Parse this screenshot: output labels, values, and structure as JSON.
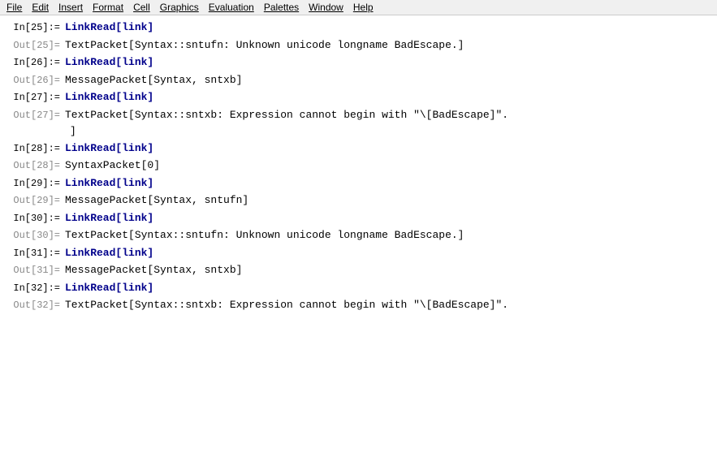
{
  "menu": {
    "items": [
      "File",
      "Edit",
      "Insert",
      "Format",
      "Cell",
      "Graphics",
      "Evaluation",
      "Palettes",
      "Window",
      "Help"
    ]
  },
  "cells": [
    {
      "id": 1,
      "in_label": "In[25]:=",
      "out_label": null,
      "type": "input",
      "content": "LinkRead[link]"
    },
    {
      "id": 2,
      "in_label": null,
      "out_label": "Out[25]=",
      "type": "output",
      "content": "TextPacket[Syntax::sntufn: Unknown unicode longname BadEscape.]"
    },
    {
      "id": 3,
      "in_label": "In[26]:=",
      "out_label": null,
      "type": "input",
      "content": "LinkRead[link]"
    },
    {
      "id": 4,
      "in_label": null,
      "out_label": "Out[26]=",
      "type": "output",
      "content": "MessagePacket[Syntax, sntxb]"
    },
    {
      "id": 5,
      "in_label": "In[27]:=",
      "out_label": null,
      "type": "input",
      "content": "LinkRead[link]"
    },
    {
      "id": 6,
      "in_label": null,
      "out_label": "Out[27]=",
      "type": "output_multiline",
      "line1": "TextPacket[Syntax::sntxb: Expression cannot begin with \"\\[BadEscape]\".",
      "line2": "]"
    },
    {
      "id": 7,
      "in_label": "In[28]:=",
      "out_label": null,
      "type": "input",
      "content": "LinkRead[link]"
    },
    {
      "id": 8,
      "in_label": null,
      "out_label": "Out[28]=",
      "type": "output",
      "content": "SyntaxPacket[0]"
    },
    {
      "id": 9,
      "in_label": "In[29]:=",
      "out_label": null,
      "type": "input",
      "content": "LinkRead[link]"
    },
    {
      "id": 10,
      "in_label": null,
      "out_label": "Out[29]=",
      "type": "output",
      "content": "MessagePacket[Syntax, sntufn]"
    },
    {
      "id": 11,
      "in_label": "In[30]:=",
      "out_label": null,
      "type": "input",
      "content": "LinkRead[link]"
    },
    {
      "id": 12,
      "in_label": null,
      "out_label": "Out[30]=",
      "type": "output",
      "content": "TextPacket[Syntax::sntufn: Unknown unicode longname BadEscape.]"
    },
    {
      "id": 13,
      "in_label": "In[31]:=",
      "out_label": null,
      "type": "input",
      "content": "LinkRead[link]"
    },
    {
      "id": 14,
      "in_label": null,
      "out_label": "Out[31]=",
      "type": "output",
      "content": "MessagePacket[Syntax, sntxb]"
    },
    {
      "id": 15,
      "in_label": "In[32]:=",
      "out_label": null,
      "type": "input",
      "content": "LinkRead[link]"
    },
    {
      "id": 16,
      "in_label": null,
      "out_label": "Out[32]=",
      "type": "output",
      "content": "TextPacket[Syntax::sntxb: Expression cannot begin with \"\\[BadEscape]\"."
    }
  ]
}
